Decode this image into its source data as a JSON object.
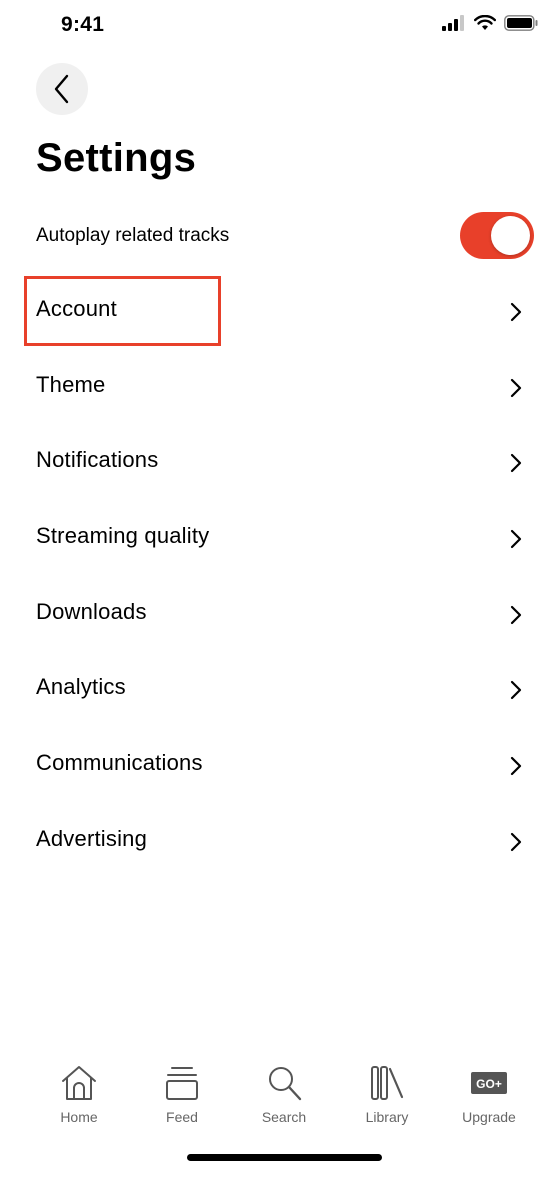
{
  "status_bar": {
    "time": "9:41"
  },
  "header": {
    "title": "Settings",
    "back_icon": "chevron-left-icon"
  },
  "autoplay": {
    "label": "Autoplay related tracks",
    "enabled": true,
    "color": "#e8402a"
  },
  "settings_items": [
    {
      "label": "Account"
    },
    {
      "label": "Theme"
    },
    {
      "label": "Notifications"
    },
    {
      "label": "Streaming quality"
    },
    {
      "label": "Downloads"
    },
    {
      "label": "Analytics"
    },
    {
      "label": "Communications"
    },
    {
      "label": "Advertising"
    }
  ],
  "highlight": {
    "target": "Account",
    "color": "#e8402a"
  },
  "tab_bar": {
    "tabs": [
      {
        "label": "Home",
        "icon": "home-icon"
      },
      {
        "label": "Feed",
        "icon": "feed-icon"
      },
      {
        "label": "Search",
        "icon": "search-icon"
      },
      {
        "label": "Library",
        "icon": "library-icon"
      },
      {
        "label": "Upgrade",
        "icon": "upgrade-icon",
        "badge": "GO+"
      }
    ]
  }
}
